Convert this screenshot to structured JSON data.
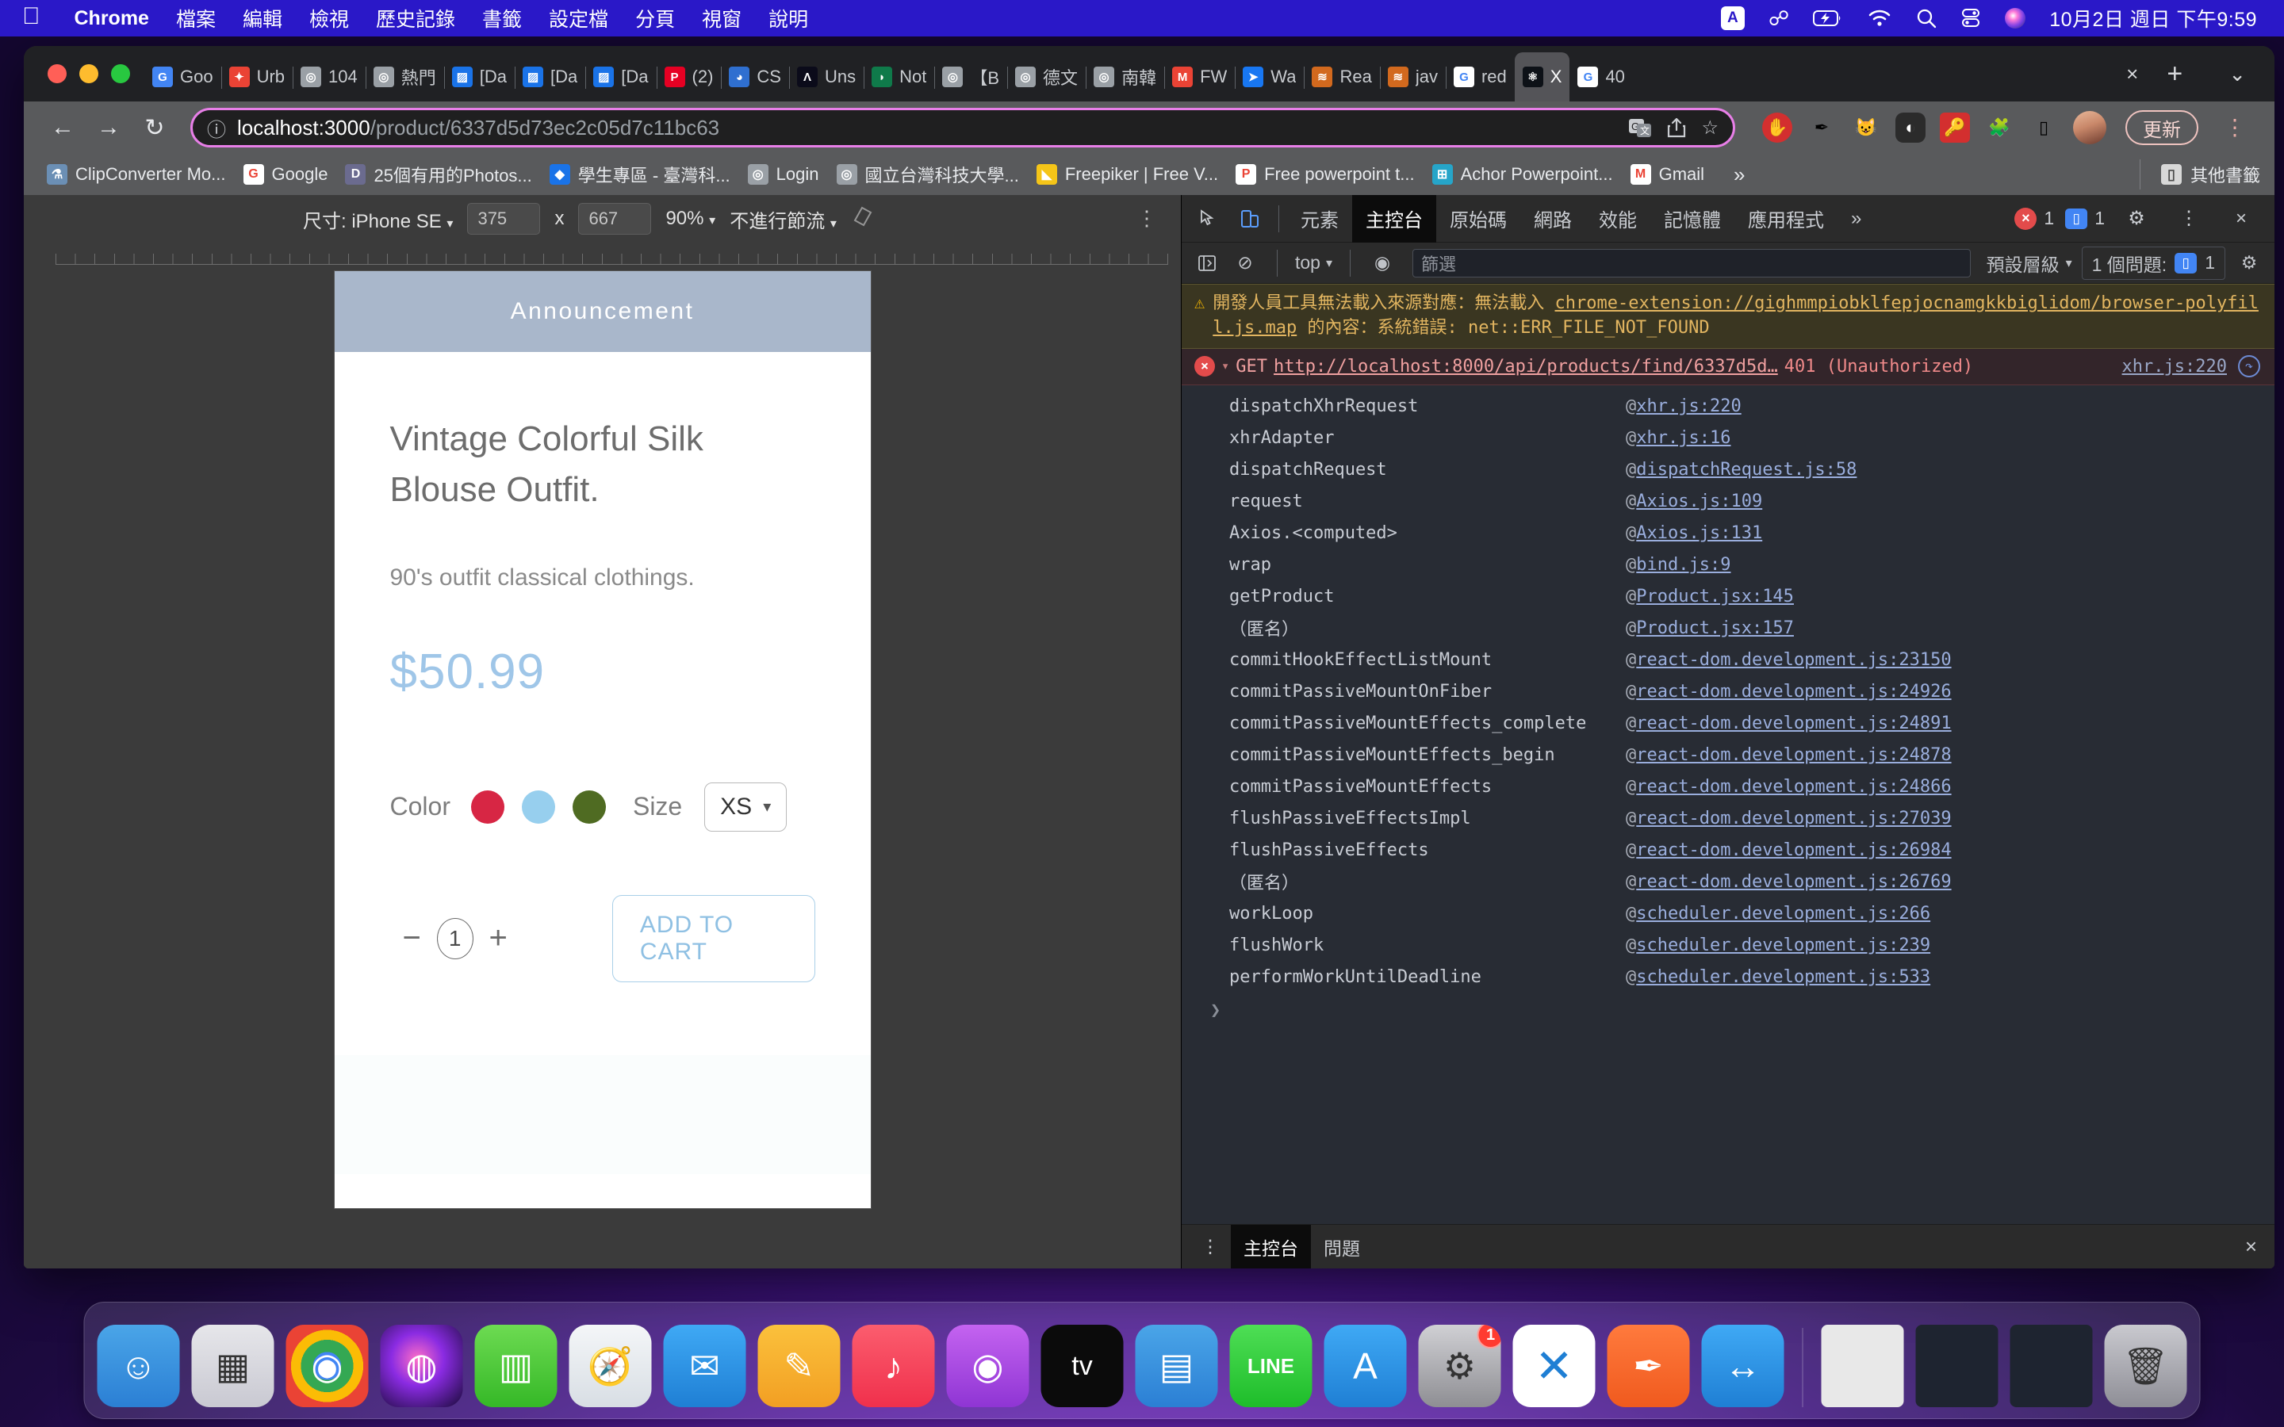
{
  "menubar": {
    "apple_icon": "apple-icon",
    "items": [
      {
        "label": "Chrome",
        "bold": true
      },
      {
        "label": "檔案",
        "bold": false
      },
      {
        "label": "編輯",
        "bold": false
      },
      {
        "label": "檢視",
        "bold": false
      },
      {
        "label": "歷史記錄",
        "bold": false
      },
      {
        "label": "書籤",
        "bold": false
      },
      {
        "label": "設定檔",
        "bold": false
      },
      {
        "label": "分頁",
        "bold": false
      },
      {
        "label": "視窗",
        "bold": false
      },
      {
        "label": "說明",
        "bold": false
      }
    ],
    "status_icons": [
      "input-source-icon",
      "bluetooth-icon",
      "battery-charging-icon",
      "wifi-icon",
      "search-icon",
      "control-center-icon",
      "siri-icon"
    ],
    "input_source": "A",
    "clock": "10月2日 週日 下午9:59"
  },
  "tabs": [
    {
      "label": "Goo",
      "fav": "G",
      "favbg": "#4285f4",
      "active": false
    },
    {
      "label": "Urb",
      "fav": "✦",
      "favbg": "#ea4335",
      "active": false
    },
    {
      "label": "104",
      "fav": "◎",
      "favbg": "#9aa0a6",
      "active": false
    },
    {
      "label": "熱門",
      "fav": "◎",
      "favbg": "#9aa0a6",
      "active": false
    },
    {
      "label": "[Da",
      "fav": "▨",
      "favbg": "#1a73e8",
      "active": false
    },
    {
      "label": "[Da",
      "fav": "▨",
      "favbg": "#1a73e8",
      "active": false
    },
    {
      "label": "[Da",
      "fav": "▨",
      "favbg": "#1a73e8",
      "active": false
    },
    {
      "label": "(2)",
      "fav": "P",
      "favbg": "#e60023",
      "active": false
    },
    {
      "label": "CS",
      "fav": "◕",
      "favbg": "#2f6fd0",
      "active": false
    },
    {
      "label": "Uns",
      "fav": "Λ",
      "favbg": "#0b0b1a",
      "active": false
    },
    {
      "label": "Not",
      "fav": "◗",
      "favbg": "#0f7a4a",
      "active": false
    },
    {
      "label": "【B",
      "fav": "◎",
      "favbg": "#9aa0a6",
      "active": false
    },
    {
      "label": "德文",
      "fav": "◎",
      "favbg": "#9aa0a6",
      "active": false
    },
    {
      "label": "南韓",
      "fav": "◎",
      "favbg": "#9aa0a6",
      "active": false
    },
    {
      "label": "FW",
      "fav": "M",
      "favbg": "#ea4335",
      "active": false
    },
    {
      "label": "Wa",
      "fav": "➤",
      "favbg": "#1877f2",
      "active": false
    },
    {
      "label": "Rea",
      "fav": "≋",
      "favbg": "#d2691e",
      "active": false
    },
    {
      "label": "jav",
      "fav": "≋",
      "favbg": "#d2691e",
      "active": false
    },
    {
      "label": "red",
      "fav": "G",
      "favbg": "#ffffff",
      "active": false
    },
    {
      "label": "X",
      "fav": "⚛",
      "favbg": "#0d1117",
      "active": true
    },
    {
      "label": "40",
      "fav": "G",
      "favbg": "#ffffff",
      "active": false
    }
  ],
  "tabstrip": {
    "close_icon": "close-icon",
    "newtab_icon": "new-tab-icon",
    "tablist_icon": "tab-search-icon"
  },
  "toolbar": {
    "back_icon": "back-arrow-icon",
    "forward_icon": "forward-arrow-icon",
    "reload_icon": "reload-icon",
    "info_icon": "site-info-icon",
    "url_host": "localhost:3000",
    "url_path": "/product/6337d5d73ec2c05d7c11bc63",
    "url_full": "localhost:3000/product/6337d5d73ec2c05d7c11bc63",
    "translate_icon": "translate-icon",
    "share_icon": "share-icon",
    "bookmark_star_icon": "bookmark-star-icon",
    "extensions": [
      {
        "name": "ublock-origin-icon",
        "glyph": "✋",
        "bg": "#d32f2f",
        "radius": "50%"
      },
      {
        "name": "pen-tool-icon",
        "glyph": "✒",
        "bg": "transparent",
        "radius": "0"
      },
      {
        "name": "bitwarden-icon",
        "glyph": "🐱",
        "bg": "transparent",
        "radius": "0"
      },
      {
        "name": "dark-reader-icon",
        "glyph": "◐",
        "bg": "#2b2b2b",
        "radius": "10px"
      },
      {
        "name": "lastpass-icon",
        "glyph": "🔑",
        "bg": "#d32f2f",
        "radius": "6px"
      },
      {
        "name": "puzzle-extensions-icon",
        "glyph": "🧩",
        "bg": "transparent",
        "radius": "0"
      },
      {
        "name": "side-panel-icon",
        "glyph": "▯",
        "bg": "transparent",
        "radius": "0"
      }
    ],
    "avatar_name": "profile-avatar",
    "update_label": "更新",
    "menu_icon": "chrome-menu-icon"
  },
  "bookmarks": {
    "items": [
      {
        "label": "ClipConverter Mo...",
        "fav": "⚗",
        "favbg": "#6b8fb5"
      },
      {
        "label": "Google",
        "fav": "G",
        "favbg": "#ffffff"
      },
      {
        "label": "25個有用的Photos...",
        "fav": "D",
        "favbg": "#6b6b8f"
      },
      {
        "label": "學生專區 - 臺灣科...",
        "fav": "◆",
        "favbg": "#1a73e8"
      },
      {
        "label": "Login",
        "fav": "◎",
        "favbg": "#9aa0a6"
      },
      {
        "label": "國立台灣科技大學...",
        "fav": "◎",
        "favbg": "#9aa0a6"
      },
      {
        "label": "Freepiker | Free V...",
        "fav": "◣",
        "favbg": "#f5c518"
      },
      {
        "label": "Free powerpoint t...",
        "fav": "P",
        "favbg": "#ffffff"
      },
      {
        "label": "Achor Powerpoint...",
        "fav": "⊞",
        "favbg": "#26a5c9"
      },
      {
        "label": "Gmail",
        "fav": "M",
        "favbg": "#ffffff"
      }
    ],
    "overflow_icon": "bookmarks-overflow-icon",
    "other_label": "其他書籤",
    "other_icon": "folder-icon"
  },
  "device_toolbar": {
    "size_label": "尺寸: iPhone SE",
    "width": "375",
    "height": "667",
    "multiply": "x",
    "zoom": "90%",
    "throttle": "不進行節流",
    "rotate_icon": "rotate-device-icon",
    "kebab_icon": "more-options-icon"
  },
  "page": {
    "announcement": "Announcement",
    "title": "Vintage Colorful Silk Blouse Outfit.",
    "description": "90's outfit classical clothings.",
    "price": "$50.99",
    "color_label": "Color",
    "colors": [
      "#d72644",
      "#97cfee",
      "#4f6b22"
    ],
    "size_label": "Size",
    "size_value": "XS",
    "size_caret_icon": "chevron-down-icon",
    "minus_label": "−",
    "quantity": "1",
    "plus_label": "+",
    "add_to_cart": "ADD TO CART"
  },
  "devtools": {
    "inspect_icon": "inspect-element-icon",
    "device_toggle_icon": "toggle-device-toolbar-icon",
    "tabs": [
      {
        "label": "元素",
        "active": false
      },
      {
        "label": "主控台",
        "active": true
      },
      {
        "label": "原始碼",
        "active": false
      },
      {
        "label": "網路",
        "active": false
      },
      {
        "label": "效能",
        "active": false
      },
      {
        "label": "記憶體",
        "active": false
      },
      {
        "label": "應用程式",
        "active": false
      }
    ],
    "more_tabs_icon": "more-tabs-icon",
    "error_count": "1",
    "warning_count": "1",
    "settings_icon": "settings-gear-icon",
    "kebab_icon": "devtools-more-icon",
    "close_icon": "close-devtools-icon",
    "console_toolbar": {
      "sidebar_icon": "console-sidebar-icon",
      "clear_icon": "clear-console-icon",
      "context": "top",
      "eye_icon": "live-expression-icon",
      "filter_placeholder": "篩選",
      "level": "預設層級",
      "issues_label": "1 個問題:",
      "issues_count": "1",
      "settings_icon": "console-settings-icon"
    },
    "warning": {
      "icon": "warning-triangle-icon",
      "prefix": "開發人員工具無法載入來源對應：無法載入 ",
      "link": "chrome-extension://gighmmpiobklfepjocnamgkkbiglidom/browser-polyfill.js.map",
      "suffix": " 的內容：系統錯誤: net::ERR_FILE_NOT_FOUND"
    },
    "error": {
      "icon": "error-circle-icon",
      "triangle": "▾",
      "method": "GET",
      "url": "http://localhost:8000/api/products/find/6337d5d…",
      "status": "401 (Unauthorized)",
      "source": "xhr.js:220",
      "refresh_icon": "replay-request-icon"
    },
    "stack": [
      {
        "fn": "dispatchXhrRequest",
        "at": "@",
        "src": "xhr.js:220"
      },
      {
        "fn": "xhrAdapter",
        "at": "@",
        "src": "xhr.js:16"
      },
      {
        "fn": "dispatchRequest",
        "at": "@",
        "src": "dispatchRequest.js:58"
      },
      {
        "fn": "request",
        "at": "@",
        "src": "Axios.js:109"
      },
      {
        "fn": "Axios.<computed>",
        "at": "@",
        "src": "Axios.js:131"
      },
      {
        "fn": "wrap",
        "at": "@",
        "src": "bind.js:9"
      },
      {
        "fn": "getProduct",
        "at": "@",
        "src": "Product.jsx:145"
      },
      {
        "fn": "（匿名）",
        "at": "@",
        "src": "Product.jsx:157"
      },
      {
        "fn": "commitHookEffectListMount",
        "at": "@",
        "src": "react-dom.development.js:23150"
      },
      {
        "fn": "commitPassiveMountOnFiber",
        "at": "@",
        "src": "react-dom.development.js:24926"
      },
      {
        "fn": "commitPassiveMountEffects_complete",
        "at": "@",
        "src": "react-dom.development.js:24891"
      },
      {
        "fn": "commitPassiveMountEffects_begin",
        "at": "@",
        "src": "react-dom.development.js:24878"
      },
      {
        "fn": "commitPassiveMountEffects",
        "at": "@",
        "src": "react-dom.development.js:24866"
      },
      {
        "fn": "flushPassiveEffectsImpl",
        "at": "@",
        "src": "react-dom.development.js:27039"
      },
      {
        "fn": "flushPassiveEffects",
        "at": "@",
        "src": "react-dom.development.js:26984"
      },
      {
        "fn": "（匿名）",
        "at": "@",
        "src": "react-dom.development.js:26769"
      },
      {
        "fn": "workLoop",
        "at": "@",
        "src": "scheduler.development.js:266"
      },
      {
        "fn": "flushWork",
        "at": "@",
        "src": "scheduler.development.js:239"
      },
      {
        "fn": "performWorkUntilDeadline",
        "at": "@",
        "src": "scheduler.development.js:533"
      }
    ],
    "prompt_caret": "❯",
    "drawer": {
      "kebab_icon": "drawer-more-icon",
      "tabs": [
        {
          "label": "主控台",
          "active": true
        },
        {
          "label": "問題",
          "active": false
        }
      ],
      "close_icon": "close-drawer-icon"
    }
  },
  "dock": {
    "items": [
      {
        "name": "finder",
        "glyph": "☺",
        "bg": "linear-gradient(180deg,#4aa5e8 0%,#2b7fd4 100%)",
        "running": true
      },
      {
        "name": "launchpad",
        "glyph": "▦",
        "bg": "linear-gradient(180deg,#e6e6ea 0%,#c9c9d2 100%)",
        "running": false
      },
      {
        "name": "google-chrome",
        "glyph": "◉",
        "bg": "radial-gradient(circle at 50% 50%, #4285f4 0 24%, #34a853 24% 45%, #fbbc05 45% 62%, #ea4335 62% 100%)",
        "running": true
      },
      {
        "name": "siri",
        "glyph": "◍",
        "bg": "radial-gradient(circle at 45% 42%, #ff6ec7 0%, #8a2be2 40%, #1a0b3a 100%)",
        "running": false
      },
      {
        "name": "numbers",
        "glyph": "▥",
        "bg": "linear-gradient(180deg,#6ddb52 0%,#35b827 100%)",
        "running": false
      },
      {
        "name": "safari",
        "glyph": "🧭",
        "bg": "linear-gradient(180deg,#f4f6f8 0%,#d8dee4 100%)",
        "running": false
      },
      {
        "name": "mail",
        "glyph": "✉",
        "bg": "linear-gradient(180deg,#3fa9f5 0%,#1f7fd4 100%)",
        "running": false
      },
      {
        "name": "notes",
        "glyph": "✎",
        "bg": "linear-gradient(180deg,#fbc13c 0%,#f29f23 100%)",
        "running": false
      },
      {
        "name": "music",
        "glyph": "♪",
        "bg": "linear-gradient(180deg,#fb5d6e 0%,#f0304c 100%)",
        "running": false
      },
      {
        "name": "podcasts",
        "glyph": "◉",
        "bg": "linear-gradient(180deg,#c463f0 0%,#8f35d4 100%)",
        "running": false
      },
      {
        "name": "apple-tv",
        "glyph": "tv",
        "bg": "#0b0b0b",
        "running": false
      },
      {
        "name": "keynote",
        "glyph": "▤",
        "bg": "linear-gradient(180deg,#4aa5e8 0%,#2b7fd4 100%)",
        "running": false
      },
      {
        "name": "line",
        "glyph": "LINE",
        "bg": "linear-gradient(180deg,#4ede55 0%,#1ebd2a 100%)",
        "running": false
      },
      {
        "name": "app-store",
        "glyph": "A",
        "bg": "linear-gradient(180deg,#3fa9f5 0%,#1f7fd4 100%)",
        "running": false
      },
      {
        "name": "system-settings",
        "glyph": "⚙",
        "bg": "linear-gradient(180deg,#d0d0d4 0%,#8e8e93 100%)",
        "badge": "1",
        "running": false
      },
      {
        "name": "visual-studio-code",
        "glyph": "✕",
        "bg": "#ffffff",
        "running": true
      },
      {
        "name": "pen-app",
        "glyph": "✒",
        "bg": "linear-gradient(180deg,#ff7a3d 0%,#f05a1e 100%)",
        "running": true
      },
      {
        "name": "figma-or-sync-app",
        "glyph": "↔",
        "bg": "linear-gradient(180deg,#3fa9f5 0%,#1f7fd4 100%)",
        "running": false
      },
      {
        "name": "pdf-document",
        "glyph": "",
        "bg": "#e8e8e8",
        "sq": true,
        "running": false
      },
      {
        "name": "code-window-1",
        "glyph": "",
        "bg": "#1e2430",
        "sq": true,
        "running": false
      },
      {
        "name": "code-window-2",
        "glyph": "",
        "bg": "#1e2430",
        "sq": true,
        "running": false
      },
      {
        "name": "trash",
        "glyph": "🗑",
        "bg": "linear-gradient(180deg,#c9c9cf 0%,#8e8e96 100%)",
        "running": false
      }
    ]
  }
}
